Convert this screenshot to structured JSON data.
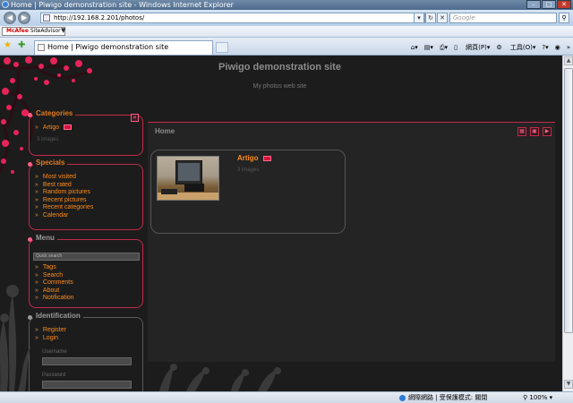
{
  "window": {
    "title": "Home | Piwigo demonstration site - Windows Internet Explorer"
  },
  "toolbar": {
    "url": "http://192.168.2.201/photos/",
    "search_placeholder": "Google",
    "mcafee_label": "SiteAdvisor",
    "mcafee_brand": "McAfee",
    "tab_title": "Home | Piwigo demonstration site",
    "page_menu": "網頁(P)",
    "tools_menu": "工具(O)"
  },
  "site": {
    "title": "Piwigo demonstration site",
    "subtitle": "My photos web site"
  },
  "sidebar": {
    "categories": {
      "title": "Categories",
      "items": [
        {
          "label": "Artigo"
        }
      ],
      "count": "3 images"
    },
    "specials": {
      "title": "Specials",
      "items": [
        {
          "label": "Most visited"
        },
        {
          "label": "Best rated"
        },
        {
          "label": "Random pictures"
        },
        {
          "label": "Recent pictures"
        },
        {
          "label": "Recent categories"
        },
        {
          "label": "Calendar"
        }
      ]
    },
    "menu": {
      "title": "Menu",
      "quick_search": "Quick search",
      "items": [
        {
          "label": "Tags"
        },
        {
          "label": "Search"
        },
        {
          "label": "Comments"
        },
        {
          "label": "About"
        },
        {
          "label": "Notification"
        }
      ]
    },
    "identification": {
      "title": "Identification",
      "items": [
        {
          "label": "Register"
        },
        {
          "label": "Login"
        }
      ],
      "username_label": "Username",
      "password_label": "Password"
    }
  },
  "content": {
    "breadcrumb": "Home",
    "album": {
      "name": "Artigo",
      "count": "3 images"
    }
  },
  "statusbar": {
    "zone": "網際網路 | 受保護模式: 關閉",
    "zoom": "100%"
  },
  "colors": {
    "accent": "#c22a4a",
    "link": "#ff8c1a",
    "background": "#1c1c1c"
  }
}
